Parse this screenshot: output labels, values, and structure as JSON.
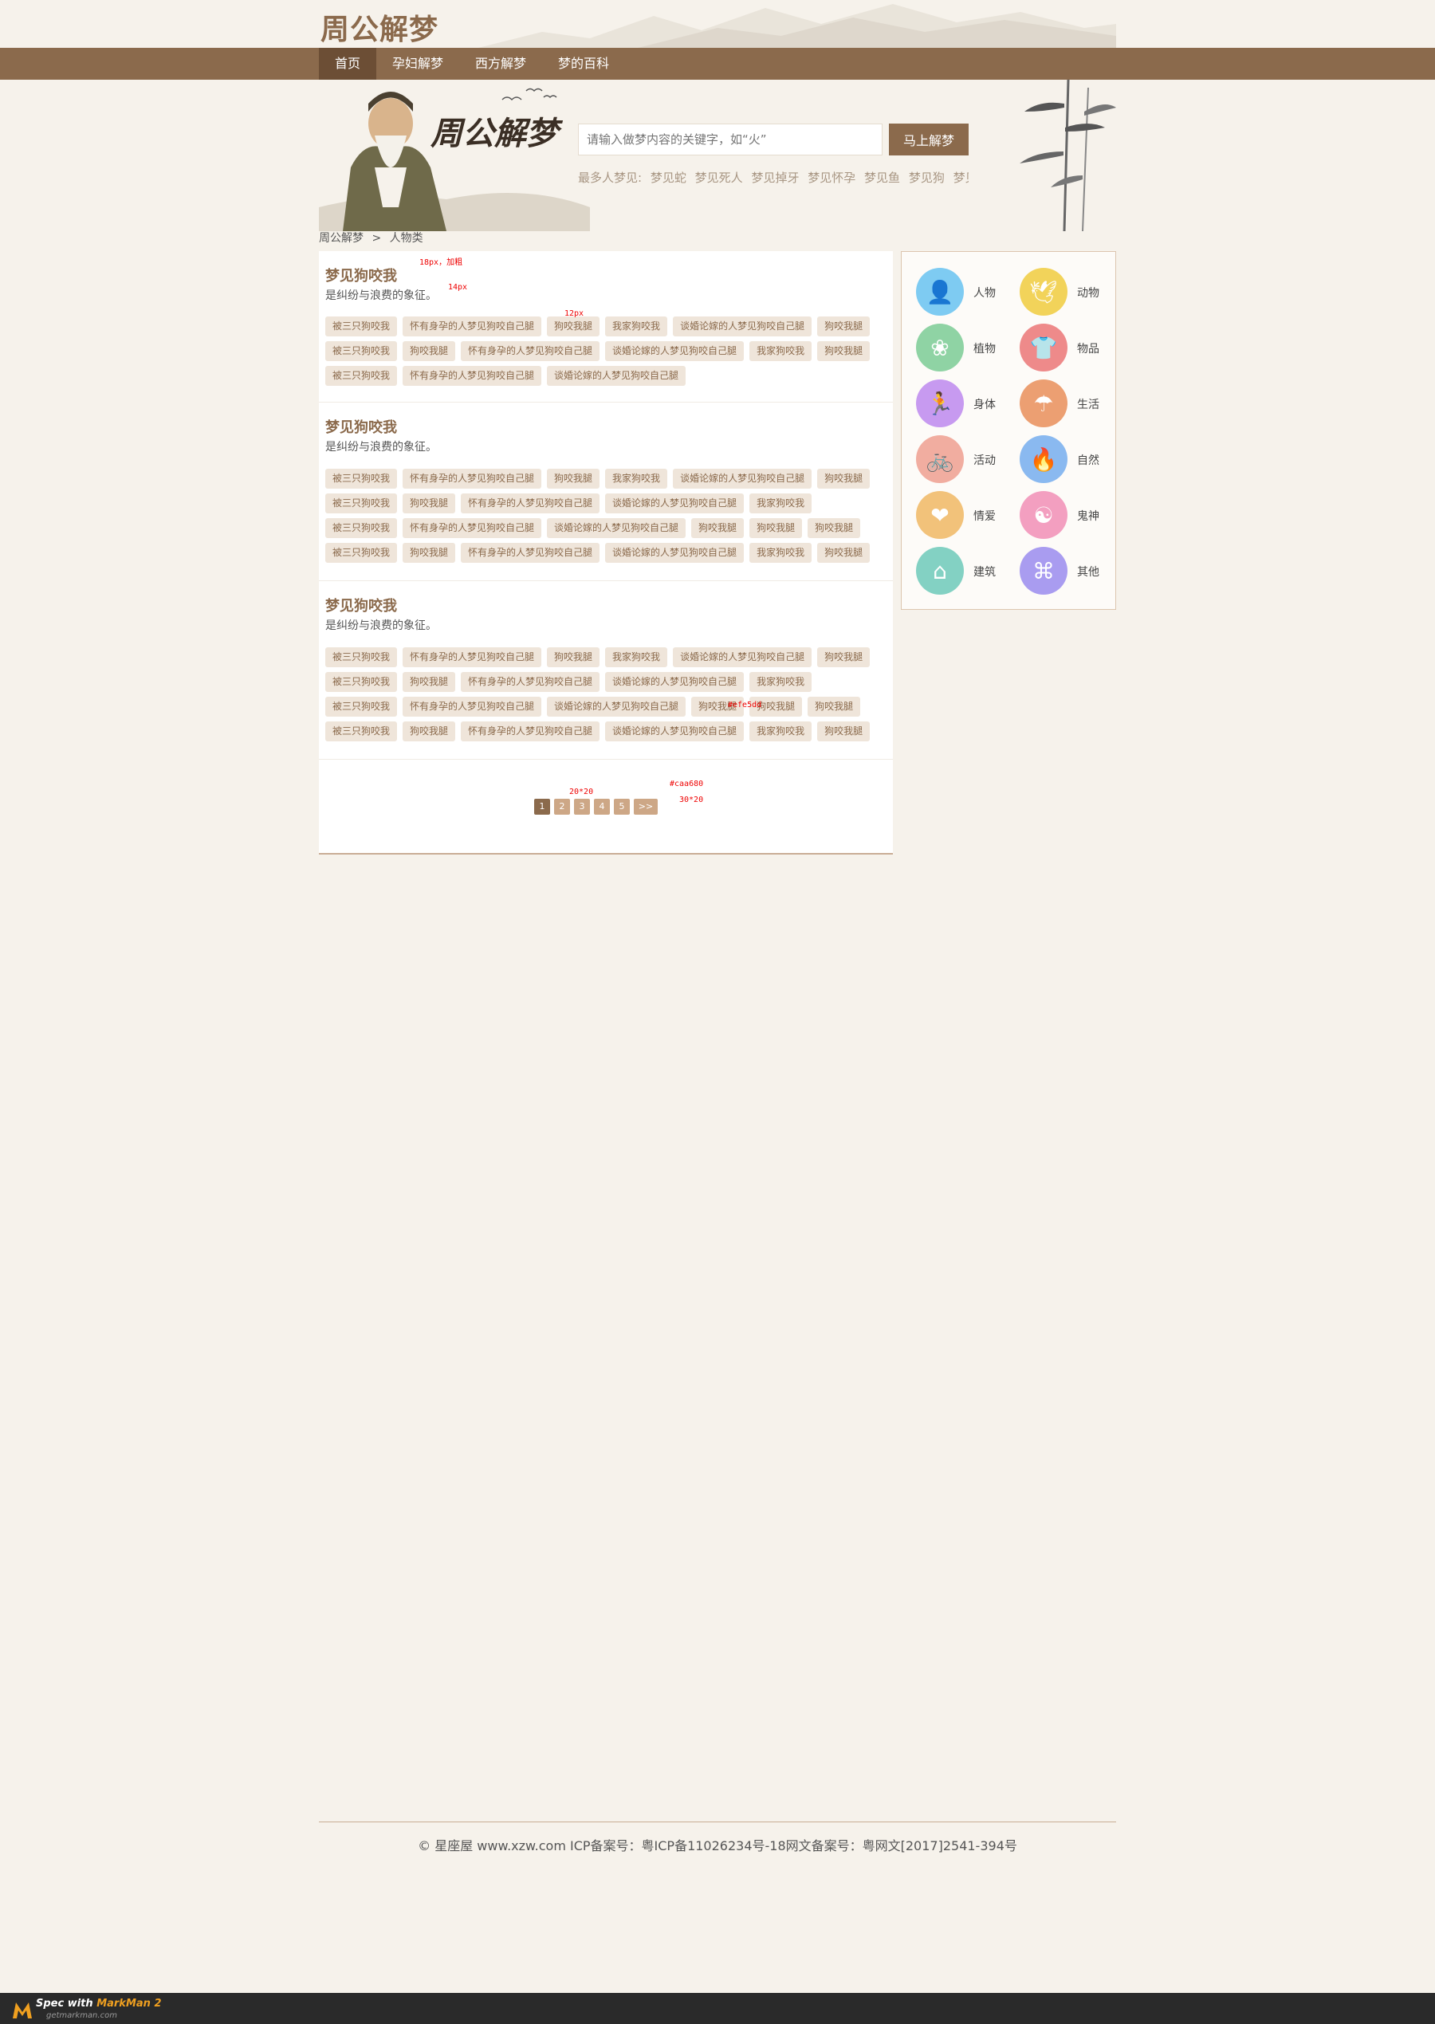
{
  "header": {
    "logo": "周公解梦"
  },
  "nav": {
    "items": [
      "首页",
      "孕妇解梦",
      "西方解梦",
      "梦的百科"
    ]
  },
  "banner": {
    "brand": "周公解梦",
    "search_placeholder": "请输入做梦内容的关键字，如“火”",
    "search_button": "马上解梦",
    "hot_label": "最多人梦见:",
    "hot_items": [
      "梦见蛇",
      "梦见死人",
      "梦见掉牙",
      "梦见怀孕",
      "梦见鱼",
      "梦见狗",
      "梦见"
    ]
  },
  "breadcrumb": {
    "home": "周公解梦",
    "sep": ">",
    "current": "人物类"
  },
  "sections": [
    {
      "title": "梦见狗咬我",
      "desc": "是纠纷与浪费的象征。",
      "rows": [
        [
          "被三只狗咬我",
          "怀有身孕的人梦见狗咬自己腿",
          "狗咬我腿",
          "我家狗咬我",
          "谈婚论嫁的人梦见狗咬自己腿",
          "狗咬我腿"
        ],
        [
          "被三只狗咬我",
          "狗咬我腿",
          "怀有身孕的人梦见狗咬自己腿",
          "谈婚论嫁的人梦见狗咬自己腿",
          "我家狗咬我",
          "狗咬我腿"
        ],
        [
          "被三只狗咬我",
          "怀有身孕的人梦见狗咬自己腿",
          "谈婚论嫁的人梦见狗咬自己腿"
        ]
      ]
    },
    {
      "title": "梦见狗咬我",
      "desc": "是纠纷与浪费的象征。",
      "rows": [
        [
          "被三只狗咬我",
          "怀有身孕的人梦见狗咬自己腿",
          "狗咬我腿",
          "我家狗咬我",
          "谈婚论嫁的人梦见狗咬自己腿",
          "狗咬我腿"
        ],
        [
          "被三只狗咬我",
          "狗咬我腿",
          "怀有身孕的人梦见狗咬自己腿",
          "谈婚论嫁的人梦见狗咬自己腿",
          "我家狗咬我"
        ],
        [
          "被三只狗咬我",
          "怀有身孕的人梦见狗咬自己腿",
          "谈婚论嫁的人梦见狗咬自己腿",
          "狗咬我腿",
          "狗咬我腿",
          "狗咬我腿"
        ],
        [
          "被三只狗咬我",
          "狗咬我腿",
          "怀有身孕的人梦见狗咬自己腿",
          "谈婚论嫁的人梦见狗咬自己腿",
          "我家狗咬我",
          "狗咬我腿"
        ]
      ]
    },
    {
      "title": "梦见狗咬我",
      "desc": "是纠纷与浪费的象征。",
      "rows": [
        [
          "被三只狗咬我",
          "怀有身孕的人梦见狗咬自己腿",
          "狗咬我腿",
          "我家狗咬我",
          "谈婚论嫁的人梦见狗咬自己腿",
          "狗咬我腿"
        ],
        [
          "被三只狗咬我",
          "狗咬我腿",
          "怀有身孕的人梦见狗咬自己腿",
          "谈婚论嫁的人梦见狗咬自己腿",
          "我家狗咬我"
        ],
        [
          "被三只狗咬我",
          "怀有身孕的人梦见狗咬自己腿",
          "谈婚论嫁的人梦见狗咬自己腿",
          "狗咬我腿",
          "狗咬我腿",
          "狗咬我腿"
        ],
        [
          "被三只狗咬我",
          "狗咬我腿",
          "怀有身孕的人梦见狗咬自己腿",
          "谈婚论嫁的人梦见狗咬自己腿",
          "我家狗咬我",
          "狗咬我腿"
        ]
      ]
    }
  ],
  "pager": {
    "pages": [
      "1",
      "2",
      "3",
      "4",
      "5"
    ],
    "next": ">>"
  },
  "annotations": {
    "a1": "18px，加粗",
    "a2": "14px",
    "a3": "12px",
    "a4": "#efe5dd",
    "a5": "20*20",
    "a6": "#caa680",
    "a7": "30*20"
  },
  "categories": [
    {
      "name": "人物",
      "color": "#7ecbf2",
      "icon": "person-icon",
      "glyph": "👤"
    },
    {
      "name": "动物",
      "color": "#f2d35a",
      "icon": "bird-icon",
      "glyph": "🕊"
    },
    {
      "name": "植物",
      "color": "#8fd3a4",
      "icon": "flower-icon",
      "glyph": "❀"
    },
    {
      "name": "物品",
      "color": "#ee8a8a",
      "icon": "shirt-icon",
      "glyph": "👕"
    },
    {
      "name": "身体",
      "color": "#c79af0",
      "icon": "running-icon",
      "glyph": "🏃"
    },
    {
      "name": "生活",
      "color": "#ec9f72",
      "icon": "umbrella-icon",
      "glyph": "☂"
    },
    {
      "name": "活动",
      "color": "#f1ada0",
      "icon": "bicycle-icon",
      "glyph": "🚲"
    },
    {
      "name": "自然",
      "color": "#8ab9f0",
      "icon": "fire-icon",
      "glyph": "🔥"
    },
    {
      "name": "情爱",
      "color": "#f2c27a",
      "icon": "heart-icon",
      "glyph": "❤"
    },
    {
      "name": "鬼神",
      "color": "#f39fc0",
      "icon": "yinyang-icon",
      "glyph": "☯"
    },
    {
      "name": "建筑",
      "color": "#83d1c3",
      "icon": "house-icon",
      "glyph": "⌂"
    },
    {
      "name": "其他",
      "color": "#a99cf0",
      "icon": "command-icon",
      "glyph": "⌘"
    }
  ],
  "footer": {
    "text": "© 星座屋 www.xzw.com ICP备案号：粤ICP备11026234号-18网文备案号：粤网文[2017]2541-394号"
  },
  "markman": {
    "title": "Spec with",
    "brand": "MarkMan 2",
    "url": "getmarkman.com"
  }
}
